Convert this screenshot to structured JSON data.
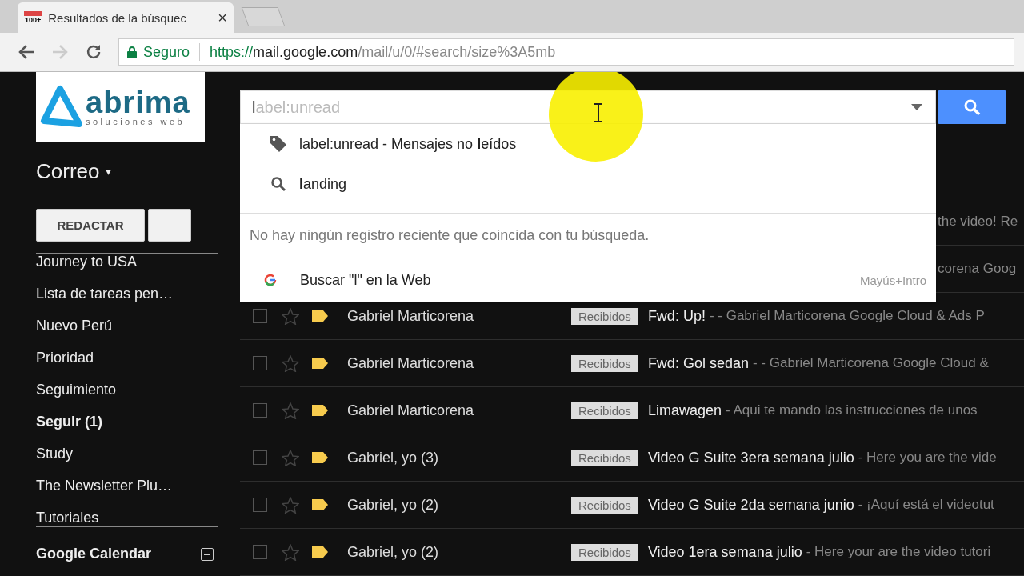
{
  "browser": {
    "tab": {
      "favicon_badge": "100+",
      "title": "Resultados de la búsquec",
      "close": "×"
    },
    "security": "Seguro",
    "url": {
      "scheme": "https://",
      "host": "mail.google.com",
      "path": "/mail/u/0/#search/size%3A5mb"
    },
    "forward_disabled": true
  },
  "logo": {
    "name": "abrima",
    "tagline": "soluciones web"
  },
  "search": {
    "value": "l",
    "completion": "abel:unread"
  },
  "suggestions": [
    {
      "kind": "label",
      "text": "label:unread - Mensajes no **l**eídos"
    },
    {
      "kind": "search",
      "text": "**l**anding"
    }
  ],
  "no_history": "No hay ningún registro reciente que coincida con tu búsqueda.",
  "web_search": {
    "text": "Buscar \"l\" en la Web",
    "shortcut": "Mayús+Intro"
  },
  "sidebar": {
    "title": "Correo",
    "title_caret": "▾",
    "compose": "REDACTAR",
    "labels": [
      {
        "name": "Journey to USA",
        "unread": false
      },
      {
        "name": "Lista de tareas pen…",
        "unread": false
      },
      {
        "name": "Nuevo Perú",
        "unread": false
      },
      {
        "name": "Prioridad",
        "unread": false
      },
      {
        "name": "Seguimiento",
        "unread": false
      },
      {
        "name": "Seguir (1)",
        "unread": true
      },
      {
        "name": "Study",
        "unread": false
      },
      {
        "name": "The Newsletter Plu…",
        "unread": false
      },
      {
        "name": "Tutoriales",
        "unread": false
      }
    ],
    "calendar": {
      "name": "Google Calendar",
      "expanded": true
    }
  },
  "messages": [
    {
      "kind": "partial",
      "fragment": "the video! Re"
    },
    {
      "kind": "partial",
      "fragment": "corena Goog"
    },
    {
      "kind": "full",
      "checked": false,
      "starred": false,
      "important": true,
      "sender": "Gabriel Marticorena",
      "label": "Recibidos",
      "subject": "Fwd: Up!",
      "snippet": "- - Gabriel Marticorena Google Cloud & Ads P"
    },
    {
      "kind": "full",
      "checked": false,
      "starred": false,
      "important": true,
      "sender": "Gabriel Marticorena",
      "label": "Recibidos",
      "subject": "Fwd: Gol sedan",
      "snippet": "- - Gabriel Marticorena Google Cloud &"
    },
    {
      "kind": "full",
      "checked": false,
      "starred": false,
      "important": true,
      "sender": "Gabriel Marticorena",
      "label": "Recibidos",
      "subject": "Limawagen",
      "snippet": "- Aqui te mando las instrucciones de unos"
    },
    {
      "kind": "full",
      "checked": false,
      "starred": false,
      "important": true,
      "sender": "Gabriel, yo (3)",
      "label": "Recibidos",
      "subject": "Video G Suite 3era semana julio",
      "snippet": "- Here you are the vide"
    },
    {
      "kind": "full",
      "checked": false,
      "starred": false,
      "important": true,
      "sender": "Gabriel, yo (2)",
      "label": "Recibidos",
      "subject": "Video G Suite 2da semana junio",
      "snippet": "- ¡Aquí está el videotut"
    },
    {
      "kind": "full",
      "checked": false,
      "starred": false,
      "important": true,
      "sender": "Gabriel, yo (2)",
      "label": "Recibidos",
      "subject": "Video 1era semana julio",
      "snippet": "- Here your are the video tutori"
    }
  ]
}
